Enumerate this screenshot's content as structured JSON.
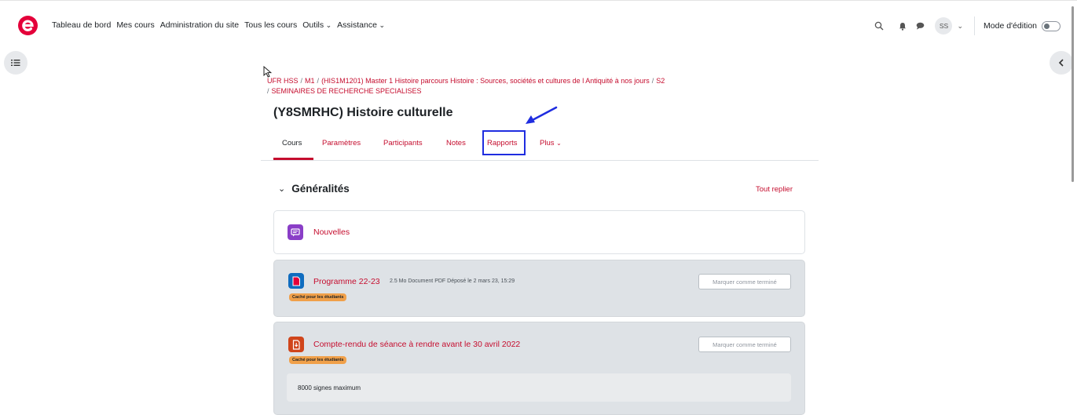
{
  "navbar": {
    "items": [
      {
        "label": "Tableau de bord"
      },
      {
        "label": "Mes cours"
      },
      {
        "label": "Administration du site"
      },
      {
        "label": "Tous les cours"
      },
      {
        "label": "Outils"
      },
      {
        "label": "Assistance"
      }
    ],
    "user_initials": "SS",
    "edit_mode_label": "Mode d'édition",
    "edit_mode_on": false
  },
  "breadcrumb": {
    "items": [
      "UFR HSS",
      "M1",
      "(HIS1M1201) Master 1 Histoire parcours Histoire : Sources, sociétés et cultures de l Antiquité à nos jours",
      "S2",
      "SEMINAIRES DE RECHERCHE SPECIALISES"
    ]
  },
  "course": {
    "title": "(Y8SMRHC) Histoire culturelle"
  },
  "tabs": [
    {
      "label": "Cours",
      "active": true
    },
    {
      "label": "Paramètres"
    },
    {
      "label": "Participants"
    },
    {
      "label": "Notes"
    },
    {
      "label": "Rapports",
      "highlighted": true
    },
    {
      "label": "Plus"
    }
  ],
  "section": {
    "title": "Généralités",
    "collapse_all": "Tout replier",
    "activities": [
      {
        "title": "Nouvelles",
        "icon": "forum-icon",
        "color": "#8a3ec7"
      },
      {
        "title": "Programme 22-23",
        "icon": "pdf-icon",
        "color": "#0f6cbf",
        "meta": "2.5 Mo Document PDF Déposé le 2 mars 23, 15:29",
        "badge": "Caché pour les étudiants",
        "button": "Marquer comme terminé"
      },
      {
        "title": "Compte-rendu de séance à rendre avant le 30 avril 2022",
        "icon": "assignment-icon",
        "color": "#d0451b",
        "badge": "Caché pour les étudiants",
        "button": "Marquer comme terminé",
        "description": "8000 signes maximum"
      }
    ]
  },
  "colors": {
    "brand": "#c50d2e",
    "logo": "#e4003a",
    "annotation": "#1f2de0",
    "badge": "#f0a04a"
  }
}
